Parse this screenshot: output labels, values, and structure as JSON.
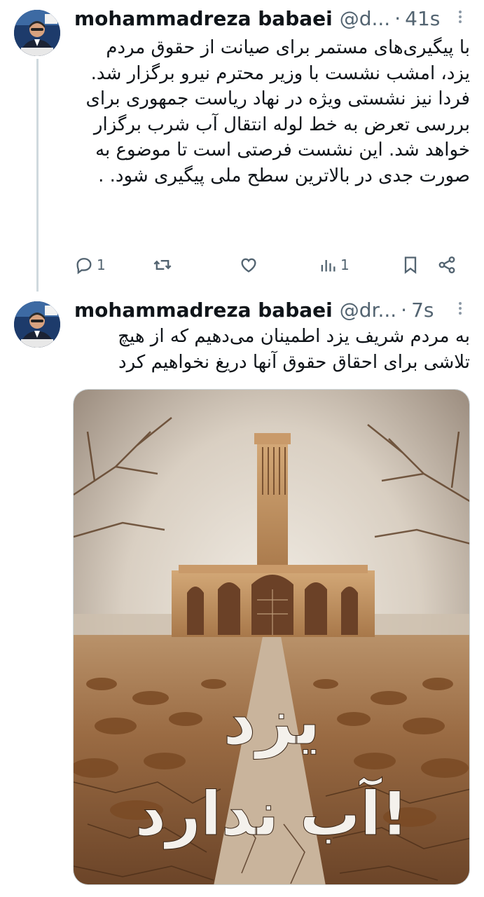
{
  "tweets": [
    {
      "author_name": "mohammadreza babaei",
      "handle": "@d...",
      "separator": "·",
      "time": "41s",
      "text": "با پیگیری‌های مستمر برای صیانت از حقوق مردم یزد، امشب نشست با وزیر محترم نیرو برگزار شد. فردا نیز نشستی ویژه در نهاد ریاست جمهوری برای بررسی تعرض به خط لوله انتقال آب شرب برگزار خواهد شد. این نشست فرصتی است تا موضوع به صورت جدی در بالاترین سطح ملی پیگیری شود. .",
      "actions": {
        "reply_count": "1",
        "repost_count": "",
        "like_count": "",
        "views_count": "1"
      }
    },
    {
      "author_name": "mohammadreza babaei",
      "handle": "@dr...",
      "separator": "·",
      "time": "7s",
      "text": "به مردم شریف یزد اطمینان می‌دهیم که از هیچ تلاشی برای احقاق حقوق آنها دریغ نخواهیم کرد",
      "media": {
        "overlay_line1": "یزد",
        "overlay_line2": "آب ندارد!"
      }
    }
  ],
  "icons": [
    "more-icon",
    "reply-icon",
    "repost-icon",
    "like-icon",
    "views-icon",
    "bookmark-icon",
    "share-icon"
  ],
  "colors": {
    "text": "#0f1419",
    "secondary": "#536471",
    "divider": "#cfd9de"
  }
}
